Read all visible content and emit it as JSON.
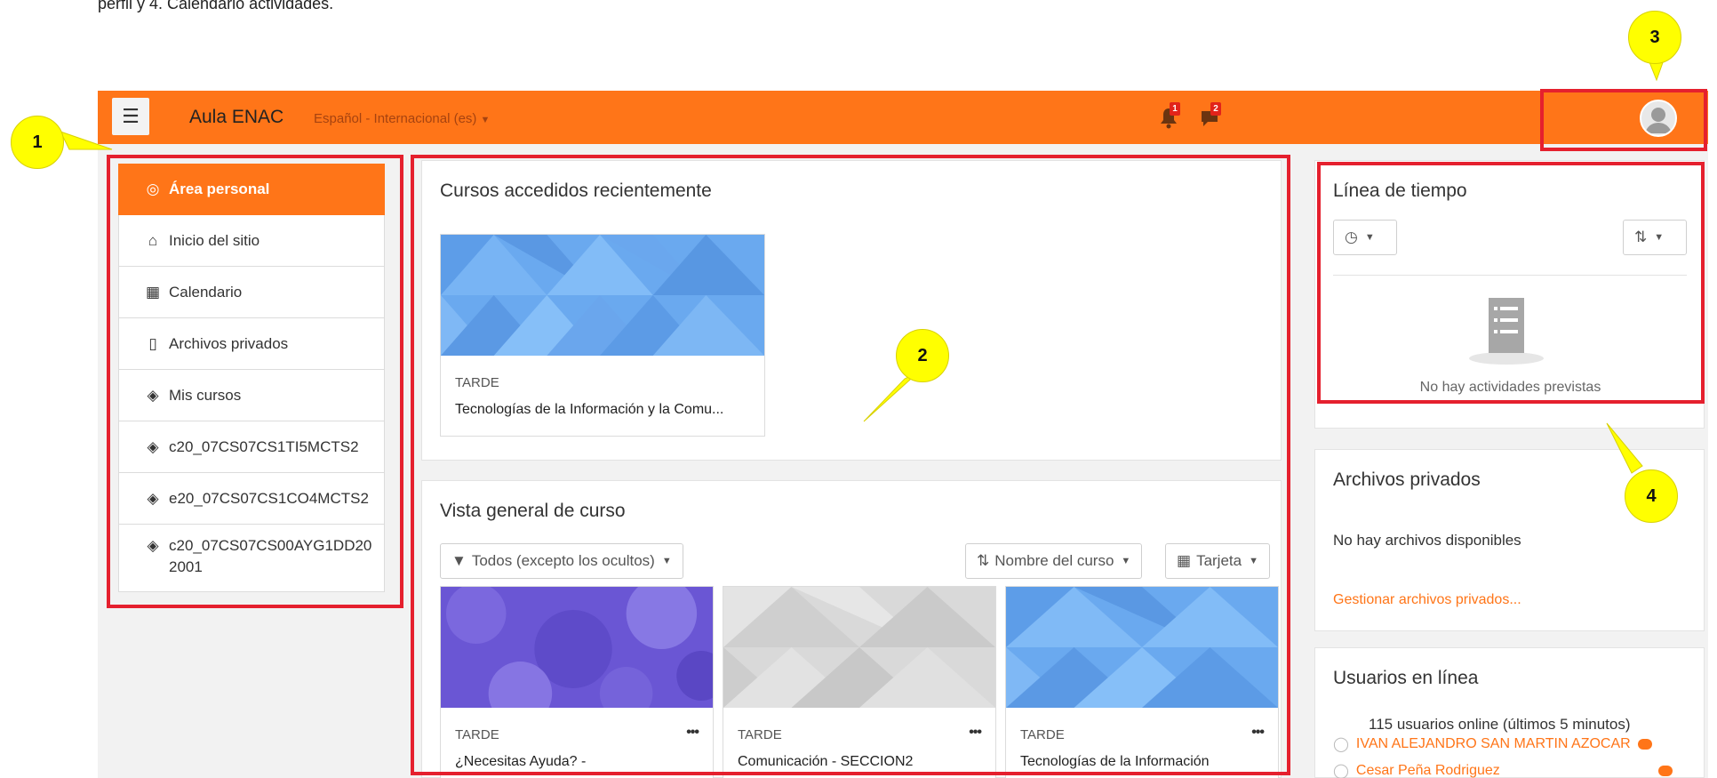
{
  "caption": "perfil y 4.  Calendario actividades.",
  "navbar": {
    "brand": "Aula ENAC",
    "language": "Español - Internacional (es)",
    "notifications_count": "1",
    "messages_count": "2",
    "accent_color": "#ff7518"
  },
  "leftnav": {
    "items": [
      {
        "label": "Área personal",
        "icon": "dashboard-icon"
      },
      {
        "label": "Inicio del sitio",
        "icon": "home-icon"
      },
      {
        "label": "Calendario",
        "icon": "calendar-icon"
      },
      {
        "label": "Archivos privados",
        "icon": "file-icon"
      },
      {
        "label": "Mis cursos",
        "icon": "graduation-cap-icon"
      },
      {
        "label": "c20_07CS07CS1TI5MCTS2",
        "icon": "graduation-cap-icon"
      },
      {
        "label": "e20_07CS07CS1CO4MCTS2",
        "icon": "graduation-cap-icon"
      },
      {
        "label": "c20_07CS07CS00AYG1DD202001",
        "icon": "graduation-cap-icon"
      }
    ]
  },
  "recent": {
    "title": "Cursos accedidos recientemente",
    "course": {
      "category": "TARDE",
      "name": "Tecnologías de la Información y la Comu..."
    }
  },
  "overview": {
    "title": "Vista general de curso",
    "filter": "Todos (excepto los ocultos)",
    "sort": "Nombre del curso",
    "view": "Tarjeta",
    "courses": [
      {
        "category": "TARDE",
        "name": "¿Necesitas Ayuda? -"
      },
      {
        "category": "TARDE",
        "name": "Comunicación - SECCION2"
      },
      {
        "category": "TARDE",
        "name": "Tecnologías de la Información"
      }
    ]
  },
  "timeline": {
    "title": "Línea de tiempo",
    "empty": "No hay actividades previstas"
  },
  "private_files": {
    "title": "Archivos privados",
    "empty": "No hay archivos disponibles",
    "manage_link": "Gestionar archivos privados..."
  },
  "online_users": {
    "title": "Usuarios en línea",
    "summary": "115 usuarios online (últimos 5 minutos)",
    "users": [
      "IVAN ALEJANDRO SAN MARTIN AZOCAR",
      "Cesar Peña Rodriguez"
    ]
  },
  "markers": [
    "1",
    "2",
    "3",
    "4"
  ]
}
